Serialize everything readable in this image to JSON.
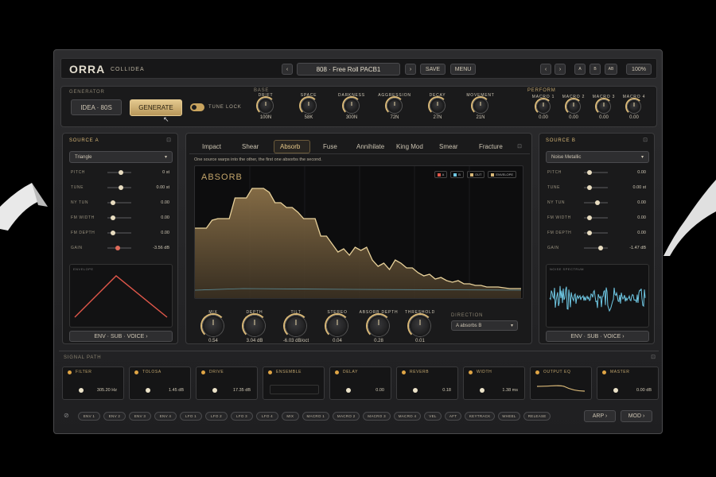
{
  "header": {
    "logo": "ORRA",
    "product": "COLLIDEA",
    "preset": "808 · Free Roll PACB1",
    "save_label": "SAVE",
    "menu_label": "MENU",
    "btn_a": "A",
    "btn_b": "B",
    "btn_ab": "AB",
    "zoom_label": "100%"
  },
  "generator": {
    "title": "GENERATOR",
    "source_value": "IDEA · 80S",
    "generate_label": "GENERATE",
    "tune_lock_label": "TUNE LOCK",
    "knob_group": "BASE",
    "knobs": [
      {
        "label": "DRIFT",
        "value": "100N"
      },
      {
        "label": "SPACE",
        "value": "58K"
      },
      {
        "label": "DARKNESS",
        "value": "300N"
      },
      {
        "label": "AGGRESSION",
        "value": "72N"
      },
      {
        "label": "DECAY",
        "value": "27N"
      },
      {
        "label": "MOVEMENT",
        "value": "21N"
      }
    ],
    "macro_group": "PERFORM",
    "macros": [
      {
        "label": "MACRO 1",
        "value": "0.00"
      },
      {
        "label": "MACRO 2",
        "value": "0.00"
      },
      {
        "label": "MACRO 3",
        "value": "0.00"
      },
      {
        "label": "MACRO 4",
        "value": "0.00"
      }
    ]
  },
  "source_a": {
    "title": "SOURCE A",
    "waveform": "Triangle",
    "rows": [
      {
        "label": "PITCH",
        "value": "0 st"
      },
      {
        "label": "TUNE",
        "value": "0.00 st"
      },
      {
        "label": "NY TUN",
        "value": "0.00"
      },
      {
        "label": "FM WIDTH",
        "value": "0.00"
      },
      {
        "label": "FM DEPTH",
        "value": "0.00"
      },
      {
        "label": "GAIN",
        "value": "-3.56 dB"
      }
    ],
    "display_label": "ENVELOPE",
    "footer": "ENV · SUB · VOICE ›"
  },
  "source_b": {
    "title": "SOURCE B",
    "waveform": "Noise Metallic",
    "rows": [
      {
        "label": "PITCH",
        "value": "0.00"
      },
      {
        "label": "TUNE",
        "value": "0.00 st"
      },
      {
        "label": "NY TUN",
        "value": "0.00"
      },
      {
        "label": "FM WIDTH",
        "value": "0.00"
      },
      {
        "label": "FM DEPTH",
        "value": "0.00"
      },
      {
        "label": "GAIN",
        "value": "-1.47 dB"
      }
    ],
    "display_label": "NOISE SPECTRUM",
    "footer": "ENV · SUB · VOICE ›"
  },
  "collide": {
    "tabs": [
      "Impact",
      "Shear",
      "Absorb",
      "Fuse",
      "Annihilate",
      "King Mod",
      "Smear",
      "Fracture"
    ],
    "active_tab": "Absorb",
    "description": "One source warps into the other, the first one absorbs the second.",
    "display_title": "ABSORB",
    "legend": [
      "A",
      "B",
      "OUT",
      "ENVELOPE"
    ],
    "knobs": [
      {
        "label": "MIX",
        "value": "0.54"
      },
      {
        "label": "DEPTH",
        "value": "3.04 dB"
      },
      {
        "label": "TILT",
        "value": "-6.03 dB/oct"
      },
      {
        "label": "STEREO",
        "value": "0.04"
      },
      {
        "label": "ABSORB DEPTH",
        "value": "0.28"
      },
      {
        "label": "THRESHOLD",
        "value": "0.01"
      }
    ],
    "direction_label": "DIRECTION",
    "direction_value": "A absorbs B"
  },
  "signal_path": {
    "title": "SIGNAL PATH",
    "modules": [
      {
        "name": "FILTER",
        "value": "305.20 Hz"
      },
      {
        "name": "TOLOSA",
        "value": "1.45 dB"
      },
      {
        "name": "DRIVE",
        "value": "17.35 dB"
      },
      {
        "name": "ENSEMBLE",
        "value": ""
      },
      {
        "name": "DELAY",
        "value": "0.00"
      },
      {
        "name": "REVERB",
        "value": "0.18"
      },
      {
        "name": "WIDTH",
        "value": "1.38 ms"
      },
      {
        "name": "OUTPUT EQ",
        "value": ""
      },
      {
        "name": "MASTER",
        "value": "0.00 dB"
      }
    ]
  },
  "mod_bar": {
    "pills": [
      "ENV 1",
      "ENV 2",
      "ENV 3",
      "ENV 4",
      "LFO 1",
      "LFO 2",
      "LFO 3",
      "LFO 4",
      "MIX",
      "MACRO 1",
      "MACRO 2",
      "MACRO 3",
      "MACRO 4",
      "VEL",
      "AFT",
      "KEYTRACK",
      "WHEEL",
      "RELEASE"
    ],
    "arp_label": "ARP ›",
    "mod_label": "MOD ›"
  },
  "colors": {
    "accent": "#d9b877",
    "active_led": "#e0a545",
    "envelope_line": "#e0574a",
    "noise_wave": "#6fc8e4"
  }
}
